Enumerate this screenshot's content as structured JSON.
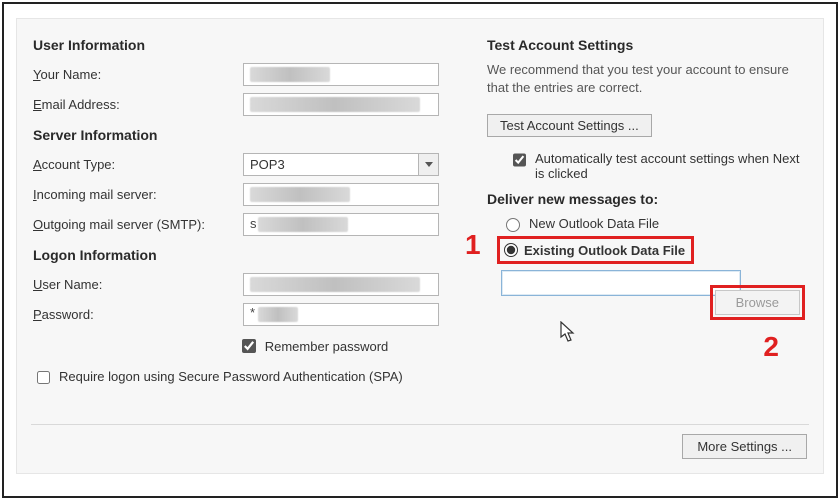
{
  "left": {
    "user_info_title": "User Information",
    "your_name_label_pre": "Y",
    "your_name_label_post": "our Name:",
    "email_label_pre": "E",
    "email_label_post": "mail Address:",
    "server_info_title": "Server Information",
    "account_type_label_pre": "A",
    "account_type_label_post": "ccount Type:",
    "account_type_value": "POP3",
    "incoming_label_pre": "I",
    "incoming_label_post": "ncoming mail server:",
    "outgoing_label_pre": "O",
    "outgoing_label_post": "utgoing mail server (SMTP):",
    "logon_info_title": "Logon Information",
    "username_label_pre": "U",
    "username_label_post": "ser Name:",
    "password_label_pre": "P",
    "password_label_post": "assword:",
    "password_value": "*",
    "remember_pw_pre": "R",
    "remember_pw_post": "emember password",
    "spa_pre": "Re",
    "spa_q": "q",
    "spa_post": "uire logon using Secure Password Authentication (SPA)",
    "outgoing_value_prefix": "s"
  },
  "right": {
    "test_title": "Test Account Settings",
    "test_desc": "We recommend that you test your account to ensure that the entries are correct.",
    "test_button_pre": "T",
    "test_button_post": "est Account Settings ...",
    "auto_test_pre": "Automatically test account ",
    "auto_test_s": "s",
    "auto_test_post": "ettings when Next is clicked",
    "deliver_title": "Deliver new messages to:",
    "radio_new_pre": "Ne",
    "radio_new_w": "w",
    "radio_new_post": " Outlook Data File",
    "radio_existing_pre": "E",
    "radio_existing_x": "x",
    "radio_existing_post": "isting Outlook Data File",
    "browse_pre": "Brow",
    "browse_s": "s",
    "browse_post": "e",
    "more_pre": "M",
    "more_post": "ore Settings ..."
  },
  "annotations": {
    "num1": "1",
    "num2": "2"
  }
}
